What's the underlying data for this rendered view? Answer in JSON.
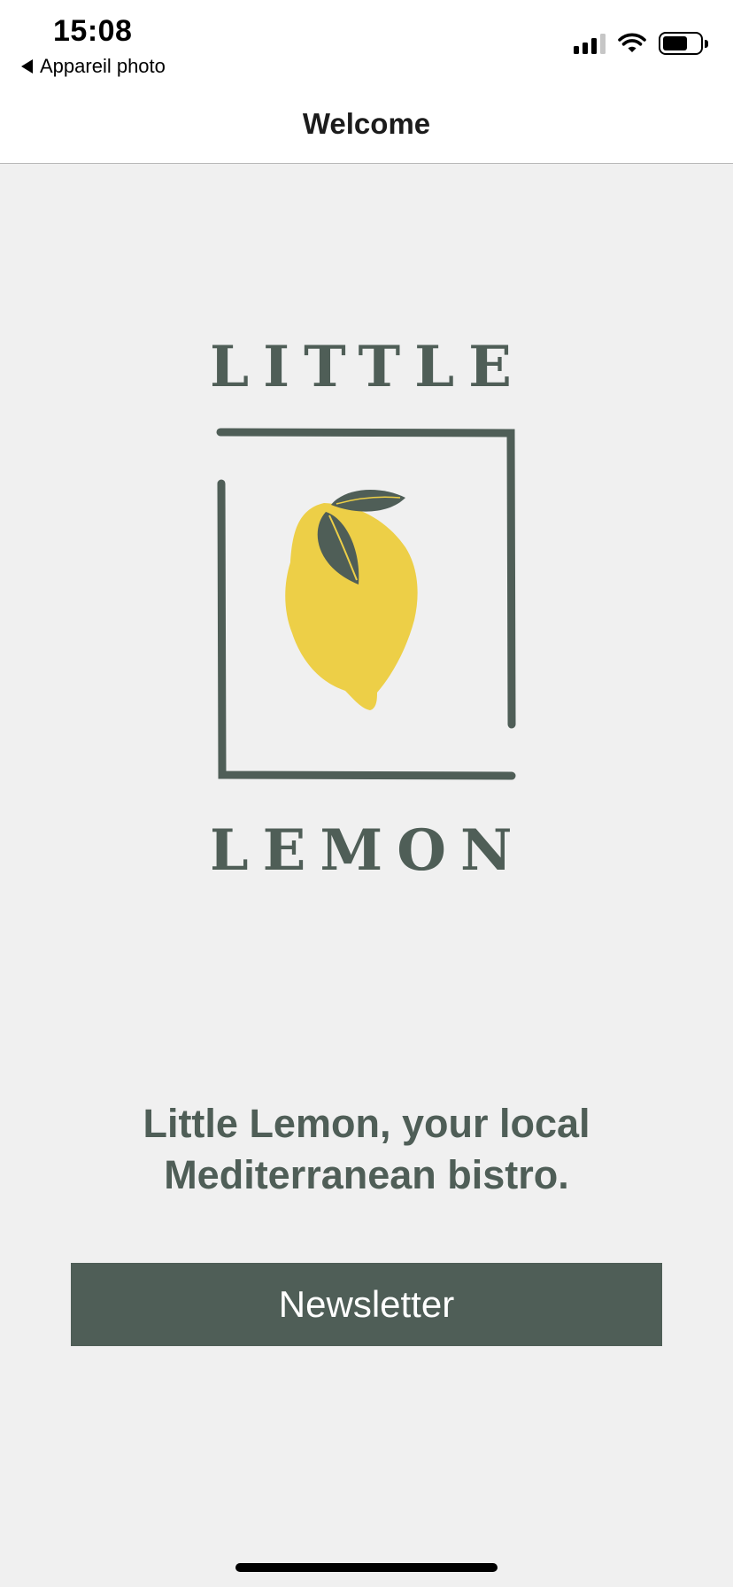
{
  "status_bar": {
    "time": "15:08",
    "back_app_label": "Appareil photo",
    "battery_level": 0.68,
    "signal_bars_active": 3,
    "signal_bars_total": 4
  },
  "nav": {
    "title": "Welcome"
  },
  "logo": {
    "top_word": "LITTLE",
    "bottom_word": "LEMON"
  },
  "main": {
    "tagline": "Little Lemon, your local Mediterranean bistro.",
    "newsletter_label": "Newsletter"
  },
  "colors": {
    "brand_green": "#4f5e57",
    "lemon_yellow": "#edcf47",
    "background": "#f0f0f0"
  }
}
